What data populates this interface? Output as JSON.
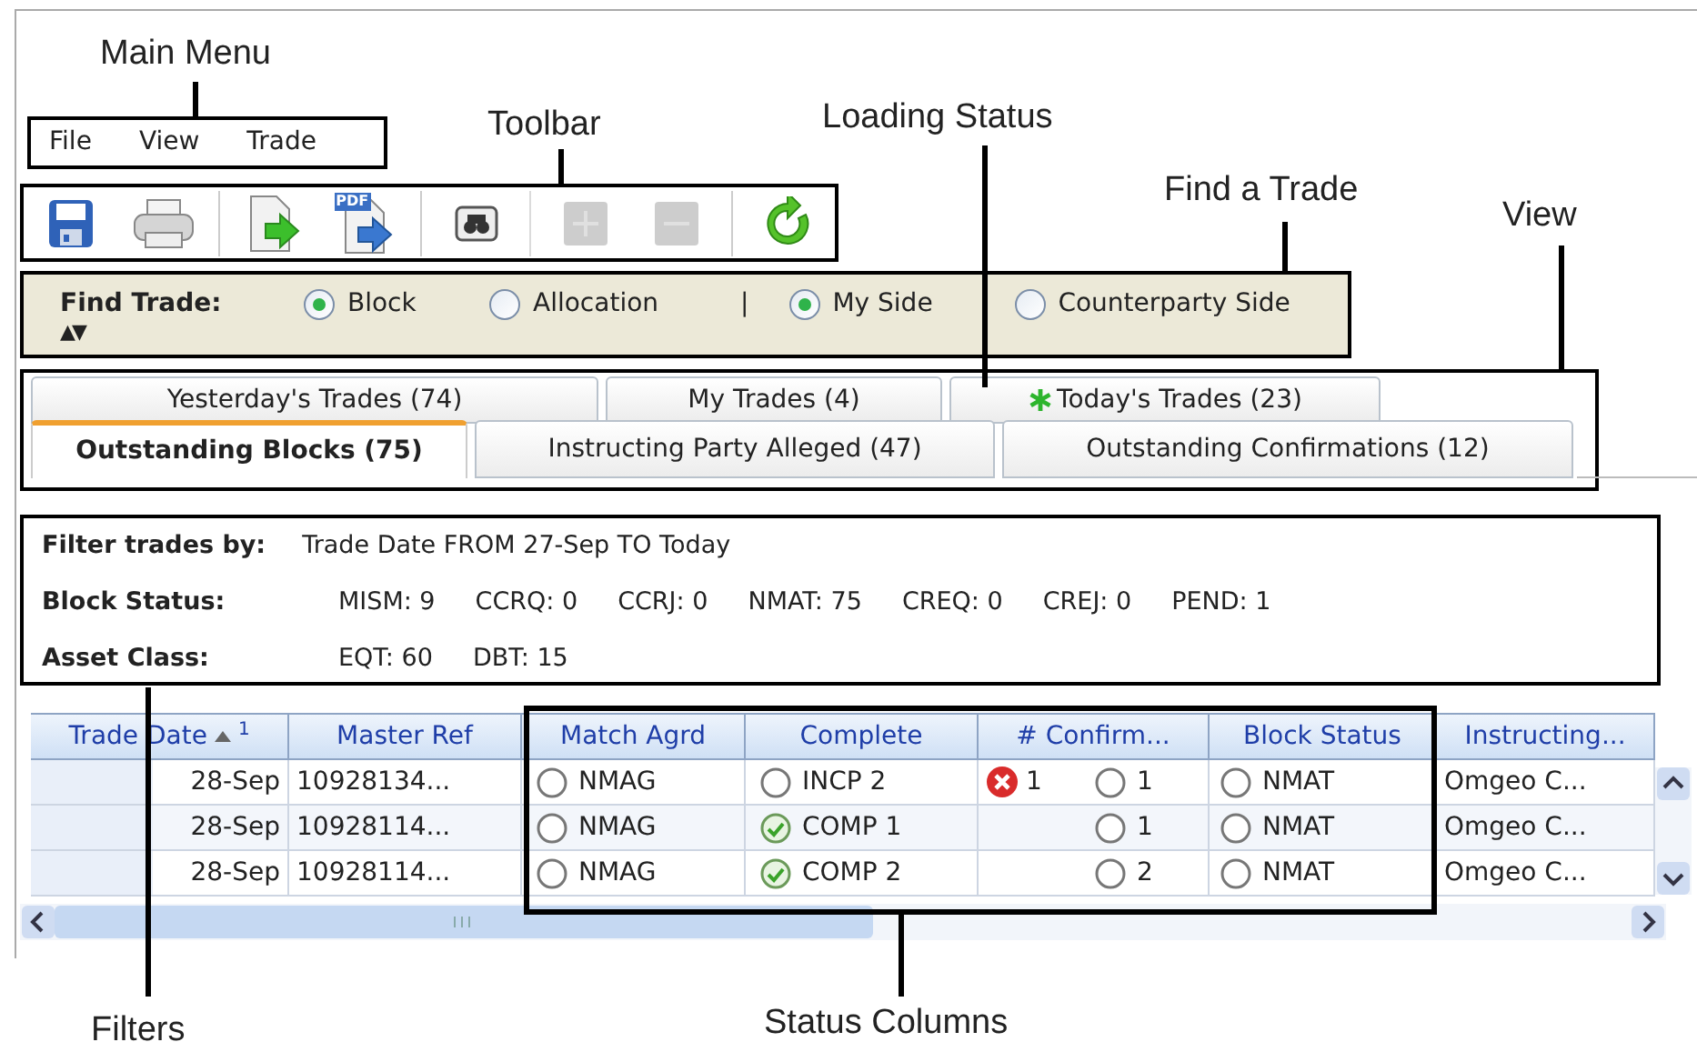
{
  "annotations": [
    {
      "text": "Main Menu"
    },
    {
      "text": "Toolbar"
    },
    {
      "text": "Loading Status"
    },
    {
      "text": "Find a Trade"
    },
    {
      "text": "View"
    },
    {
      "text": "Filters"
    },
    {
      "text": "Status Columns"
    }
  ],
  "menu": [
    {
      "label": "File"
    },
    {
      "label": "View"
    },
    {
      "label": "Trade"
    }
  ],
  "toolbar": [
    {
      "kind": "save",
      "disabled": false,
      "separator_before": false
    },
    {
      "kind": "print",
      "disabled": false,
      "separator_before": false
    },
    {
      "kind": "export",
      "disabled": false,
      "separator_before": true
    },
    {
      "kind": "export_pdf",
      "disabled": false,
      "separator_before": false,
      "badge": "PDF"
    },
    {
      "kind": "find",
      "disabled": false,
      "separator_before": true
    },
    {
      "kind": "add",
      "disabled": true,
      "separator_before": true
    },
    {
      "kind": "remove",
      "disabled": true,
      "separator_before": false
    },
    {
      "kind": "refresh",
      "disabled": false,
      "separator_before": true
    }
  ],
  "find_trade": {
    "label": "Find Trade:",
    "toggle": "▲▼",
    "divider": "|",
    "type_options": [
      {
        "label": "Block",
        "selected": true
      },
      {
        "label": "Allocation",
        "selected": false
      }
    ],
    "side_options": [
      {
        "label": "My Side",
        "selected": true
      },
      {
        "label": "Counterparty Side",
        "selected": false
      }
    ]
  },
  "tabs": {
    "rows": [
      [
        {
          "label": "Yesterday's Trades (74)",
          "selected": false,
          "loading": false
        },
        {
          "label": "My Trades (4)",
          "selected": false,
          "loading": false
        },
        {
          "label": "Today's Trades (23)",
          "selected": false,
          "loading": true
        }
      ],
      [
        {
          "label": "Outstanding Blocks (75)",
          "selected": true,
          "loading": false
        },
        {
          "label": "Instructing Party Alleged (47)",
          "selected": false,
          "loading": false
        },
        {
          "label": "Outstanding Confirmations (12)",
          "selected": false,
          "loading": false
        }
      ]
    ]
  },
  "filters": {
    "rows": [
      {
        "label": "Filter trades by:",
        "values": [
          "Trade Date FROM 27-Sep TO Today"
        ]
      },
      {
        "label": "Block Status:",
        "values": [
          "MISM: 9",
          "CCRQ: 0",
          "CCRJ: 0",
          "NMAT: 75",
          "CREQ: 0",
          "CREJ: 0",
          "PEND: 1"
        ]
      },
      {
        "label": "Asset Class:",
        "values": [
          "EQT: 60",
          "DBT: 15"
        ]
      }
    ]
  },
  "table": {
    "columns": [
      {
        "label": "Trade Date",
        "sort_rank": "1"
      },
      {
        "label": "Master Ref"
      },
      {
        "label": "Match Agrd"
      },
      {
        "label": "Complete"
      },
      {
        "label": "# Confirm..."
      },
      {
        "label": "Block Status"
      },
      {
        "label": "Instructing..."
      }
    ],
    "rows": [
      {
        "trade_date": "28-Sep",
        "master_ref": "10928134...",
        "match_agrd": {
          "text": "NMAG",
          "kind": "pending"
        },
        "complete": {
          "text": "INCP 2",
          "kind": "pending"
        },
        "confirm_failed": {
          "text": "1",
          "kind": "error"
        },
        "confirm_open": {
          "text": "1",
          "kind": "pending"
        },
        "block_status": {
          "text": "NMAT",
          "kind": "pending"
        },
        "instructing": "Omgeo C..."
      },
      {
        "trade_date": "28-Sep",
        "master_ref": "10928114...",
        "match_agrd": {
          "text": "NMAG",
          "kind": "pending"
        },
        "complete": {
          "text": "COMP 1",
          "kind": "ok"
        },
        "confirm_open": {
          "text": "1",
          "kind": "pending"
        },
        "block_status": {
          "text": "NMAT",
          "kind": "pending"
        },
        "instructing": "Omgeo C..."
      },
      {
        "trade_date": "28-Sep",
        "master_ref": "10928114...",
        "match_agrd": {
          "text": "NMAG",
          "kind": "pending"
        },
        "complete": {
          "text": "COMP 2",
          "kind": "ok"
        },
        "confirm_open": {
          "text": "2",
          "kind": "pending"
        },
        "block_status": {
          "text": "NMAT",
          "kind": "pending"
        },
        "instructing": "Omgeo C..."
      }
    ]
  }
}
